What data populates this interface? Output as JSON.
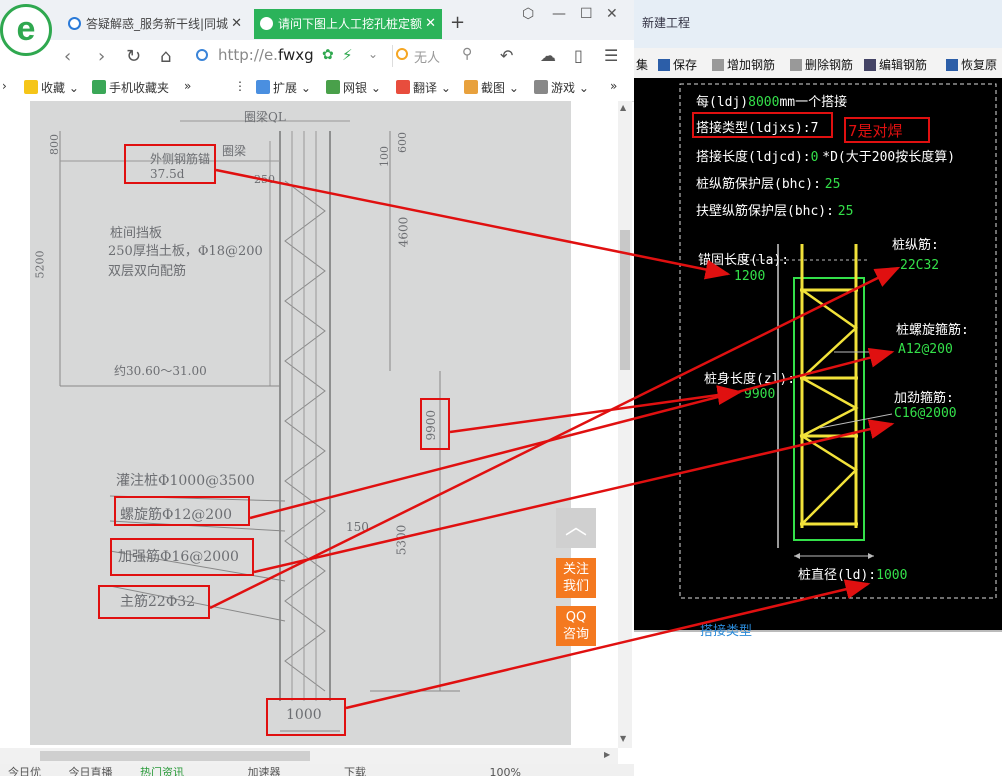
{
  "browser": {
    "tabs": [
      {
        "title": "答疑解惑_服务新干线|同城"
      },
      {
        "title": "请问下图上人工挖孔桩定额"
      }
    ],
    "url_prefix": "http://e.",
    "url_domain": "fwxg",
    "search_placeholder": "无人",
    "bookmarks": [
      "收藏",
      "手机收藏夹",
      "扩展",
      "网银",
      "翻译",
      "截图",
      "游戏"
    ],
    "status_items": [
      "今日优",
      "今日直播",
      "热门资讯",
      "加速器",
      "下载",
      "100%"
    ],
    "side_buttons": {
      "follow": "关注我们",
      "qq": "QQ咨询"
    }
  },
  "drawing": {
    "ring_beam": "圈梁QL",
    "outer_rebar": "外侧钢筋锚",
    "outer_rebar_len": "37.5d",
    "ring_beam2": "圈梁",
    "dim_800": "800",
    "dim_100": "100",
    "dim_600": "600",
    "dim_250": "250",
    "wall_title": "桩间挡板",
    "wall_spec": "250厚挡土板，Φ18@200",
    "wall_dist": "双层双向配筋",
    "dim_5200": "5200",
    "dim_4600": "4600",
    "elevation": "约30.60～31.00",
    "dim_9900": "9900",
    "pile_spec": "灌注桩Φ1000@3500",
    "spiral": "螺旋筋Φ12@200",
    "stiffener": "加强筋Φ16@2000",
    "main_bar": "主筋22Φ32",
    "dim_150": "150",
    "dim_5300": "5300",
    "dim_1000": "1000"
  },
  "software": {
    "toolbar": [
      "集",
      "保存",
      "增加钢筋",
      "删除钢筋",
      "编辑钢筋",
      "恢复原"
    ],
    "title_fragment": "新建工程",
    "every_label": "每(ldj)",
    "every_value": "8000",
    "every_unit": "mm一个搭接",
    "lap_type_label": "搭接类型(ldjxs):",
    "lap_type_value": "7",
    "annotation": "7是对焊",
    "lap_len_label": "搭接长度(ldjcd):",
    "lap_len_value": "0",
    "lap_len_note": "*D(大于200按长度算)",
    "cover_label": "桩纵筋保护层(bhc):",
    "cover_value": "25",
    "wall_cover_label": "扶壁纵筋保护层(bhc):",
    "wall_cover_value": "25",
    "anchor_label": "锚固长度(la):",
    "anchor_value": "1200",
    "long_bar_label": "桩纵筋:",
    "long_bar_value": "22C32",
    "spiral_label": "桩螺旋箍筋:",
    "spiral_value": "A12@200",
    "body_len_label": "桩身长度(zl):",
    "body_len_value": "9900",
    "stiff_label": "加劲箍筋:",
    "stiff_value": "C16@2000",
    "diameter_label": "桩直径(ld):",
    "diameter_value": "1000",
    "bottom_text": "搭接类型",
    "colors": {
      "black_bg": "#000000",
      "green_text": "#34e04a",
      "annotation_red": "#e01010",
      "pile_yellow": "#f2e23a"
    }
  }
}
